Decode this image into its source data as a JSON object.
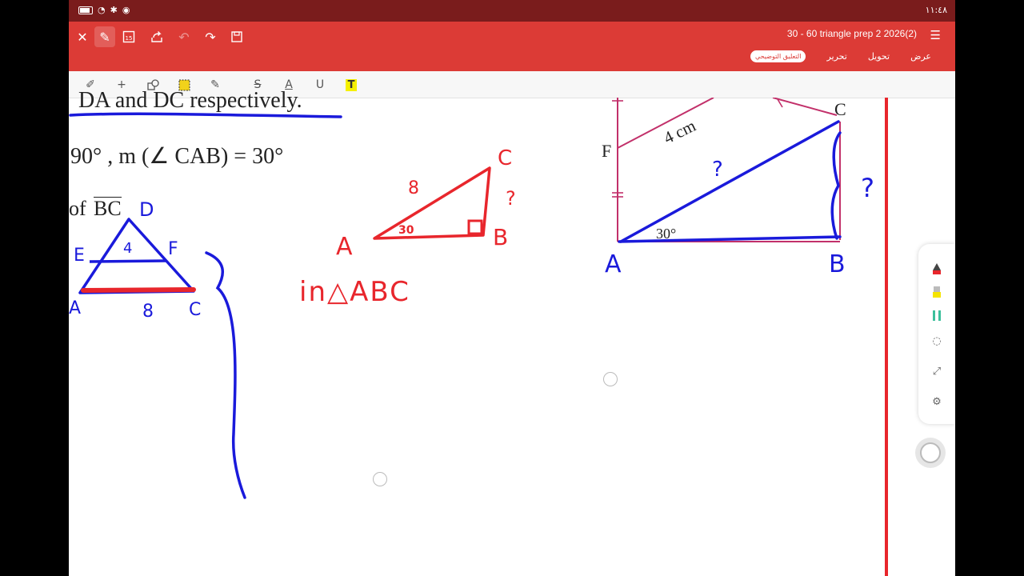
{
  "status_bar": {
    "time": "١١:٤٨"
  },
  "top_bar": {
    "doc_title": "30   - 60 triangle prep 2 2026(2)",
    "tabs": [
      "عرض",
      "تحويل",
      "تحرير",
      "التعليق التوضيحي"
    ],
    "active_tab": "التعليق التوضيحي"
  },
  "annotation_toolbar": {
    "tools": [
      "pen-settings",
      "add",
      "shapes",
      "select-area",
      "highlighter",
      "strikethrough",
      "text-color",
      "underline",
      "text-highlight"
    ]
  },
  "page": {
    "printed": {
      "line1": "DA and DC respectively.",
      "line2": "90° , m (∠ CAB) = 30°",
      "line3_of": "of",
      "line3_bc": "BC",
      "fig_label_F": "F",
      "fig_label_C": "C",
      "fig_side": "4 cm",
      "fig_angle": "30°"
    },
    "handwriting": {
      "small_tri": {
        "D": "D",
        "E": "E",
        "F": "F",
        "A": "A",
        "C": "C",
        "top": "4",
        "base": "8"
      },
      "red_tri": {
        "A": "A",
        "B": "B",
        "C": "C",
        "hyp": "8",
        "angle": "30",
        "q": "?",
        "note": "in△ABC"
      },
      "right_fig": {
        "A": "A",
        "B": "B",
        "q1": "?",
        "q2": "?"
      }
    }
  },
  "colors": {
    "status_bar": "#7a1c1c",
    "top_bar": "#dc3b36",
    "ink_blue": "#1a1adb",
    "ink_red": "#e8262c",
    "fig_line": "#c2306a"
  }
}
